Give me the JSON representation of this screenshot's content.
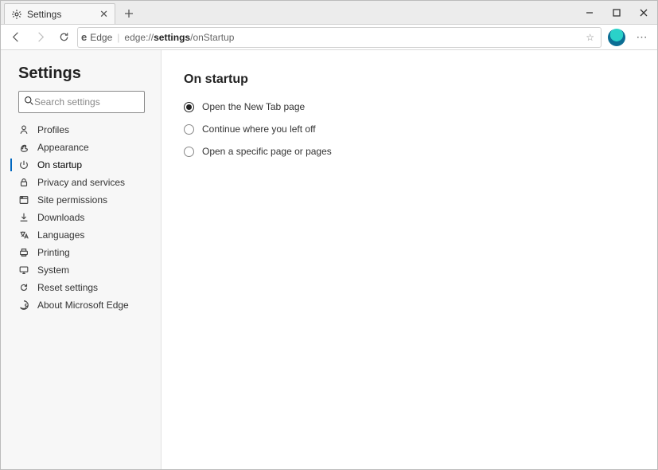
{
  "tab": {
    "title": "Settings"
  },
  "toolbar": {
    "edge_label": "Edge",
    "url_prefix": "edge://",
    "url_bold": "settings",
    "url_suffix": "/onStartup"
  },
  "sidebar": {
    "heading": "Settings",
    "search_placeholder": "Search settings",
    "items": [
      {
        "label": "Profiles",
        "icon": "person-icon",
        "active": false
      },
      {
        "label": "Appearance",
        "icon": "appearance-icon",
        "active": false
      },
      {
        "label": "On startup",
        "icon": "power-icon",
        "active": true
      },
      {
        "label": "Privacy and services",
        "icon": "lock-icon",
        "active": false
      },
      {
        "label": "Site permissions",
        "icon": "site-icon",
        "active": false
      },
      {
        "label": "Downloads",
        "icon": "download-icon",
        "active": false
      },
      {
        "label": "Languages",
        "icon": "language-icon",
        "active": false
      },
      {
        "label": "Printing",
        "icon": "printer-icon",
        "active": false
      },
      {
        "label": "System",
        "icon": "system-icon",
        "active": false
      },
      {
        "label": "Reset settings",
        "icon": "reset-icon",
        "active": false
      },
      {
        "label": "About Microsoft Edge",
        "icon": "edge-icon",
        "active": false
      }
    ]
  },
  "main": {
    "heading": "On startup",
    "options": [
      {
        "label": "Open the New Tab page",
        "selected": true
      },
      {
        "label": "Continue where you left off",
        "selected": false
      },
      {
        "label": "Open a specific page or pages",
        "selected": false
      }
    ]
  }
}
